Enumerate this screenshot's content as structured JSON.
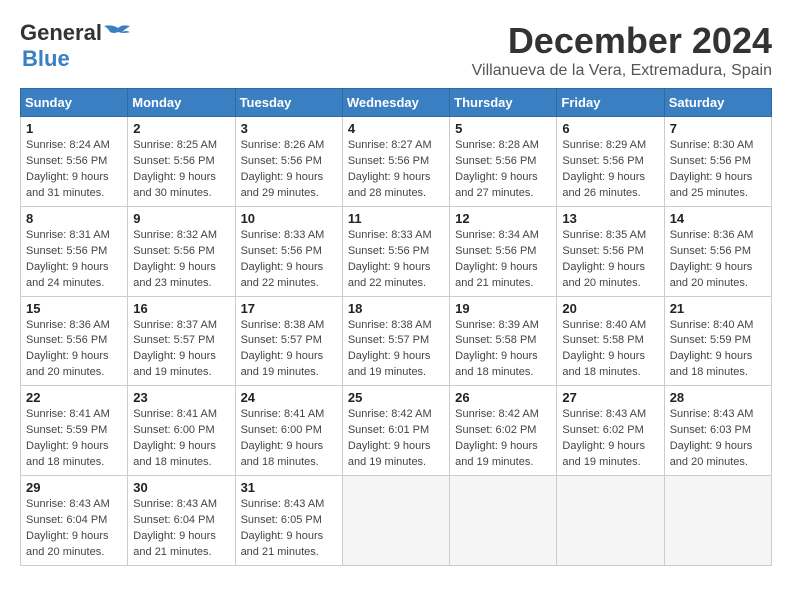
{
  "header": {
    "logo_line1": "General",
    "logo_line2": "Blue",
    "month": "December 2024",
    "location": "Villanueva de la Vera, Extremadura, Spain"
  },
  "weekdays": [
    "Sunday",
    "Monday",
    "Tuesday",
    "Wednesday",
    "Thursday",
    "Friday",
    "Saturday"
  ],
  "weeks": [
    [
      {
        "day": "1",
        "sunrise": "Sunrise: 8:24 AM",
        "sunset": "Sunset: 5:56 PM",
        "daylight": "Daylight: 9 hours and 31 minutes."
      },
      {
        "day": "2",
        "sunrise": "Sunrise: 8:25 AM",
        "sunset": "Sunset: 5:56 PM",
        "daylight": "Daylight: 9 hours and 30 minutes."
      },
      {
        "day": "3",
        "sunrise": "Sunrise: 8:26 AM",
        "sunset": "Sunset: 5:56 PM",
        "daylight": "Daylight: 9 hours and 29 minutes."
      },
      {
        "day": "4",
        "sunrise": "Sunrise: 8:27 AM",
        "sunset": "Sunset: 5:56 PM",
        "daylight": "Daylight: 9 hours and 28 minutes."
      },
      {
        "day": "5",
        "sunrise": "Sunrise: 8:28 AM",
        "sunset": "Sunset: 5:56 PM",
        "daylight": "Daylight: 9 hours and 27 minutes."
      },
      {
        "day": "6",
        "sunrise": "Sunrise: 8:29 AM",
        "sunset": "Sunset: 5:56 PM",
        "daylight": "Daylight: 9 hours and 26 minutes."
      },
      {
        "day": "7",
        "sunrise": "Sunrise: 8:30 AM",
        "sunset": "Sunset: 5:56 PM",
        "daylight": "Daylight: 9 hours and 25 minutes."
      }
    ],
    [
      {
        "day": "8",
        "sunrise": "Sunrise: 8:31 AM",
        "sunset": "Sunset: 5:56 PM",
        "daylight": "Daylight: 9 hours and 24 minutes."
      },
      {
        "day": "9",
        "sunrise": "Sunrise: 8:32 AM",
        "sunset": "Sunset: 5:56 PM",
        "daylight": "Daylight: 9 hours and 23 minutes."
      },
      {
        "day": "10",
        "sunrise": "Sunrise: 8:33 AM",
        "sunset": "Sunset: 5:56 PM",
        "daylight": "Daylight: 9 hours and 22 minutes."
      },
      {
        "day": "11",
        "sunrise": "Sunrise: 8:33 AM",
        "sunset": "Sunset: 5:56 PM",
        "daylight": "Daylight: 9 hours and 22 minutes."
      },
      {
        "day": "12",
        "sunrise": "Sunrise: 8:34 AM",
        "sunset": "Sunset: 5:56 PM",
        "daylight": "Daylight: 9 hours and 21 minutes."
      },
      {
        "day": "13",
        "sunrise": "Sunrise: 8:35 AM",
        "sunset": "Sunset: 5:56 PM",
        "daylight": "Daylight: 9 hours and 20 minutes."
      },
      {
        "day": "14",
        "sunrise": "Sunrise: 8:36 AM",
        "sunset": "Sunset: 5:56 PM",
        "daylight": "Daylight: 9 hours and 20 minutes."
      }
    ],
    [
      {
        "day": "15",
        "sunrise": "Sunrise: 8:36 AM",
        "sunset": "Sunset: 5:56 PM",
        "daylight": "Daylight: 9 hours and 20 minutes."
      },
      {
        "day": "16",
        "sunrise": "Sunrise: 8:37 AM",
        "sunset": "Sunset: 5:57 PM",
        "daylight": "Daylight: 9 hours and 19 minutes."
      },
      {
        "day": "17",
        "sunrise": "Sunrise: 8:38 AM",
        "sunset": "Sunset: 5:57 PM",
        "daylight": "Daylight: 9 hours and 19 minutes."
      },
      {
        "day": "18",
        "sunrise": "Sunrise: 8:38 AM",
        "sunset": "Sunset: 5:57 PM",
        "daylight": "Daylight: 9 hours and 19 minutes."
      },
      {
        "day": "19",
        "sunrise": "Sunrise: 8:39 AM",
        "sunset": "Sunset: 5:58 PM",
        "daylight": "Daylight: 9 hours and 18 minutes."
      },
      {
        "day": "20",
        "sunrise": "Sunrise: 8:40 AM",
        "sunset": "Sunset: 5:58 PM",
        "daylight": "Daylight: 9 hours and 18 minutes."
      },
      {
        "day": "21",
        "sunrise": "Sunrise: 8:40 AM",
        "sunset": "Sunset: 5:59 PM",
        "daylight": "Daylight: 9 hours and 18 minutes."
      }
    ],
    [
      {
        "day": "22",
        "sunrise": "Sunrise: 8:41 AM",
        "sunset": "Sunset: 5:59 PM",
        "daylight": "Daylight: 9 hours and 18 minutes."
      },
      {
        "day": "23",
        "sunrise": "Sunrise: 8:41 AM",
        "sunset": "Sunset: 6:00 PM",
        "daylight": "Daylight: 9 hours and 18 minutes."
      },
      {
        "day": "24",
        "sunrise": "Sunrise: 8:41 AM",
        "sunset": "Sunset: 6:00 PM",
        "daylight": "Daylight: 9 hours and 18 minutes."
      },
      {
        "day": "25",
        "sunrise": "Sunrise: 8:42 AM",
        "sunset": "Sunset: 6:01 PM",
        "daylight": "Daylight: 9 hours and 19 minutes."
      },
      {
        "day": "26",
        "sunrise": "Sunrise: 8:42 AM",
        "sunset": "Sunset: 6:02 PM",
        "daylight": "Daylight: 9 hours and 19 minutes."
      },
      {
        "day": "27",
        "sunrise": "Sunrise: 8:43 AM",
        "sunset": "Sunset: 6:02 PM",
        "daylight": "Daylight: 9 hours and 19 minutes."
      },
      {
        "day": "28",
        "sunrise": "Sunrise: 8:43 AM",
        "sunset": "Sunset: 6:03 PM",
        "daylight": "Daylight: 9 hours and 20 minutes."
      }
    ],
    [
      {
        "day": "29",
        "sunrise": "Sunrise: 8:43 AM",
        "sunset": "Sunset: 6:04 PM",
        "daylight": "Daylight: 9 hours and 20 minutes."
      },
      {
        "day": "30",
        "sunrise": "Sunrise: 8:43 AM",
        "sunset": "Sunset: 6:04 PM",
        "daylight": "Daylight: 9 hours and 21 minutes."
      },
      {
        "day": "31",
        "sunrise": "Sunrise: 8:43 AM",
        "sunset": "Sunset: 6:05 PM",
        "daylight": "Daylight: 9 hours and 21 minutes."
      },
      null,
      null,
      null,
      null
    ]
  ]
}
